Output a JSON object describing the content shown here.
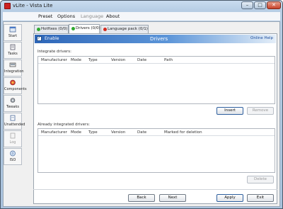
{
  "window": {
    "title": "vLite - Vista Lite",
    "controls": {
      "minimize": "–",
      "maximize": "□",
      "close": "✕"
    }
  },
  "menu": {
    "items": [
      {
        "label": "Preset",
        "enabled": true
      },
      {
        "label": "Options",
        "enabled": true
      },
      {
        "label": "Language",
        "enabled": false
      },
      {
        "label": "About",
        "enabled": true
      }
    ]
  },
  "sidebar": {
    "items": [
      {
        "label": "Start",
        "icon": "start-icon"
      },
      {
        "label": "Tasks",
        "icon": "tasks-icon"
      },
      {
        "label": "Integration",
        "icon": "integration-icon"
      },
      {
        "label": "Components",
        "icon": "components-icon"
      },
      {
        "label": "Tweaks",
        "icon": "tweaks-icon"
      },
      {
        "label": "Unattended",
        "icon": "unattended-icon"
      },
      {
        "label": "Log",
        "icon": "log-icon",
        "enabled": false
      },
      {
        "label": "ISO",
        "icon": "iso-icon"
      }
    ]
  },
  "tabs": [
    {
      "label": "Hotfixes (0/0)",
      "status_color": "#2fa82f",
      "active": false
    },
    {
      "label": "Drivers (0/0)",
      "status_color": "#2fa82f",
      "active": true
    },
    {
      "label": "Language pack (0/1)",
      "status_color": "#d42a1e",
      "active": false
    }
  ],
  "header": {
    "enable_label": "Enable",
    "enable_checked": true,
    "title": "Drivers",
    "online_help": "Online Help"
  },
  "integrate": {
    "label": "Integrate drivers:",
    "columns": [
      "Manufacturer",
      "Mode",
      "Type",
      "Version",
      "Date",
      "Path"
    ],
    "insert_button": "Insert",
    "remove_button": "Remove"
  },
  "integrated": {
    "label": "Already integrated drivers:",
    "columns": [
      "Manufacturer",
      "Mode",
      "Type",
      "Version",
      "Date",
      "Marked for deletion"
    ],
    "delete_button": "Delete"
  },
  "footer": {
    "back": "Back",
    "next": "Next",
    "apply": "Apply",
    "exit": "Exit"
  },
  "colors": {
    "header_gradient_start": "#2e66b8",
    "header_gradient_end": "#e4eef8",
    "status_ok": "#2fa82f",
    "status_error": "#d42a1e"
  }
}
